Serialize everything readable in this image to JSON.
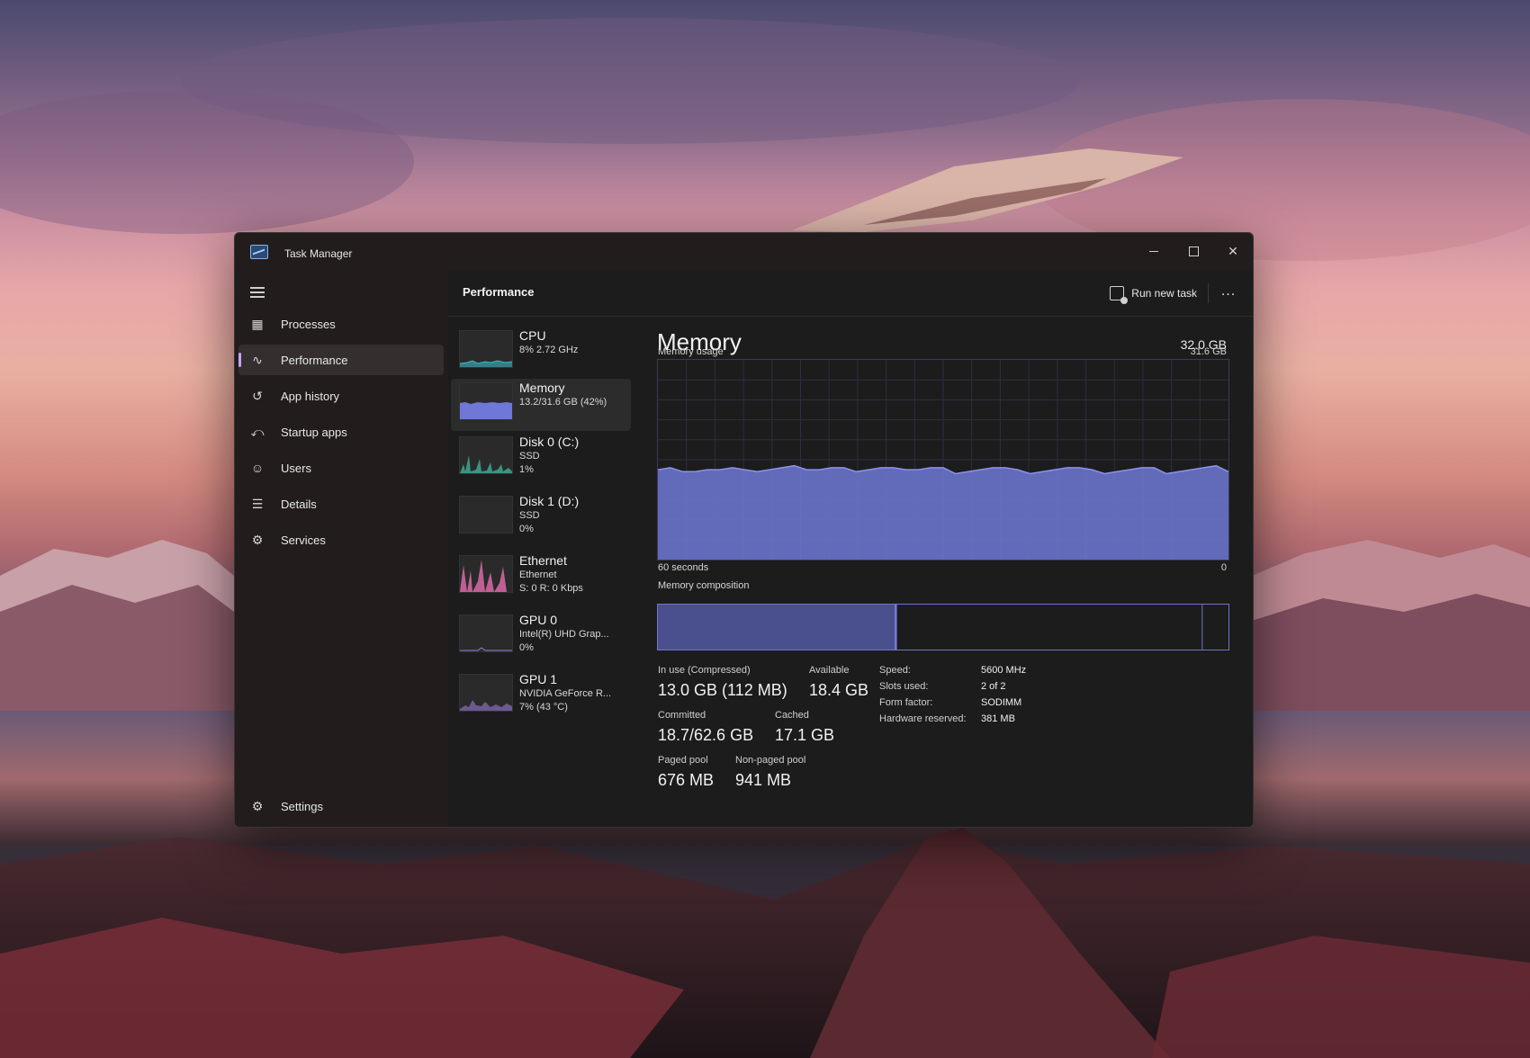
{
  "window": {
    "title": "Task Manager"
  },
  "sidebar": {
    "items": [
      {
        "label": "Processes",
        "icon": "processes-icon"
      },
      {
        "label": "Performance",
        "icon": "performance-icon",
        "active": true
      },
      {
        "label": "App history",
        "icon": "history-icon"
      },
      {
        "label": "Startup apps",
        "icon": "startup-icon"
      },
      {
        "label": "Users",
        "icon": "users-icon"
      },
      {
        "label": "Details",
        "icon": "details-icon"
      },
      {
        "label": "Services",
        "icon": "services-icon"
      }
    ],
    "settings": {
      "label": "Settings",
      "icon": "gear-icon"
    }
  },
  "header": {
    "title": "Performance",
    "run_new_task": "Run new task",
    "more": "..."
  },
  "resources": [
    {
      "name": "CPU",
      "lines": [
        "8% 2.72 GHz"
      ],
      "color": "#3fb8c7"
    },
    {
      "name": "Memory",
      "lines": [
        "13.2/31.6 GB (42%)"
      ],
      "color": "#6f78d6",
      "active": true
    },
    {
      "name": "Disk 0 (C:)",
      "lines": [
        "SSD",
        "1%"
      ],
      "color": "#3fb8a0"
    },
    {
      "name": "Disk 1 (D:)",
      "lines": [
        "SSD",
        "0%"
      ],
      "color": "#3fb8a0"
    },
    {
      "name": "Ethernet",
      "lines": [
        "Ethernet",
        "S: 0 R: 0 Kbps"
      ],
      "color": "#d96aa8"
    },
    {
      "name": "GPU 0",
      "lines": [
        "Intel(R) UHD Grap...",
        "0%"
      ],
      "color": "#9a7ad6"
    },
    {
      "name": "GPU 1",
      "lines": [
        "NVIDIA GeForce R...",
        "7% (43 °C)"
      ],
      "color": "#9a7ad6"
    }
  ],
  "memory": {
    "title": "Memory",
    "total": "32.0 GB",
    "usage_label": "Memory usage",
    "usage_max": "31.6 GB",
    "time_label": "60 seconds",
    "time_end": "0",
    "composition_label": "Memory composition",
    "composition": {
      "in_use_fraction": 0.415,
      "modified_fraction": 0.004,
      "standby_fraction": 0.535,
      "free_fraction": 0.046
    },
    "usage_series": [
      0.45,
      0.46,
      0.44,
      0.44,
      0.45,
      0.45,
      0.46,
      0.45,
      0.44,
      0.45,
      0.46,
      0.47,
      0.45,
      0.45,
      0.46,
      0.46,
      0.44,
      0.45,
      0.46,
      0.46,
      0.45,
      0.45,
      0.46,
      0.46,
      0.43,
      0.44,
      0.45,
      0.46,
      0.46,
      0.45,
      0.43,
      0.44,
      0.45,
      0.46,
      0.46,
      0.45,
      0.43,
      0.44,
      0.45,
      0.46,
      0.46,
      0.43,
      0.44,
      0.45,
      0.46,
      0.47,
      0.44
    ],
    "stats": [
      {
        "label": "In use (Compressed)",
        "value": "13.0 GB (112 MB)"
      },
      {
        "label": "Available",
        "value": "18.4 GB"
      },
      {
        "label": "Committed",
        "value": "18.7/62.6 GB"
      },
      {
        "label": "Cached",
        "value": "17.1 GB"
      },
      {
        "label": "Paged pool",
        "value": "676 MB"
      },
      {
        "label": "Non-paged pool",
        "value": "941 MB"
      }
    ],
    "specs": [
      {
        "key": "Speed:",
        "value": "5600 MHz"
      },
      {
        "key": "Slots used:",
        "value": "2 of 2"
      },
      {
        "key": "Form factor:",
        "value": "SODIMM"
      },
      {
        "key": "Hardware reserved:",
        "value": "381 MB"
      }
    ],
    "color": "#6f78d6"
  }
}
